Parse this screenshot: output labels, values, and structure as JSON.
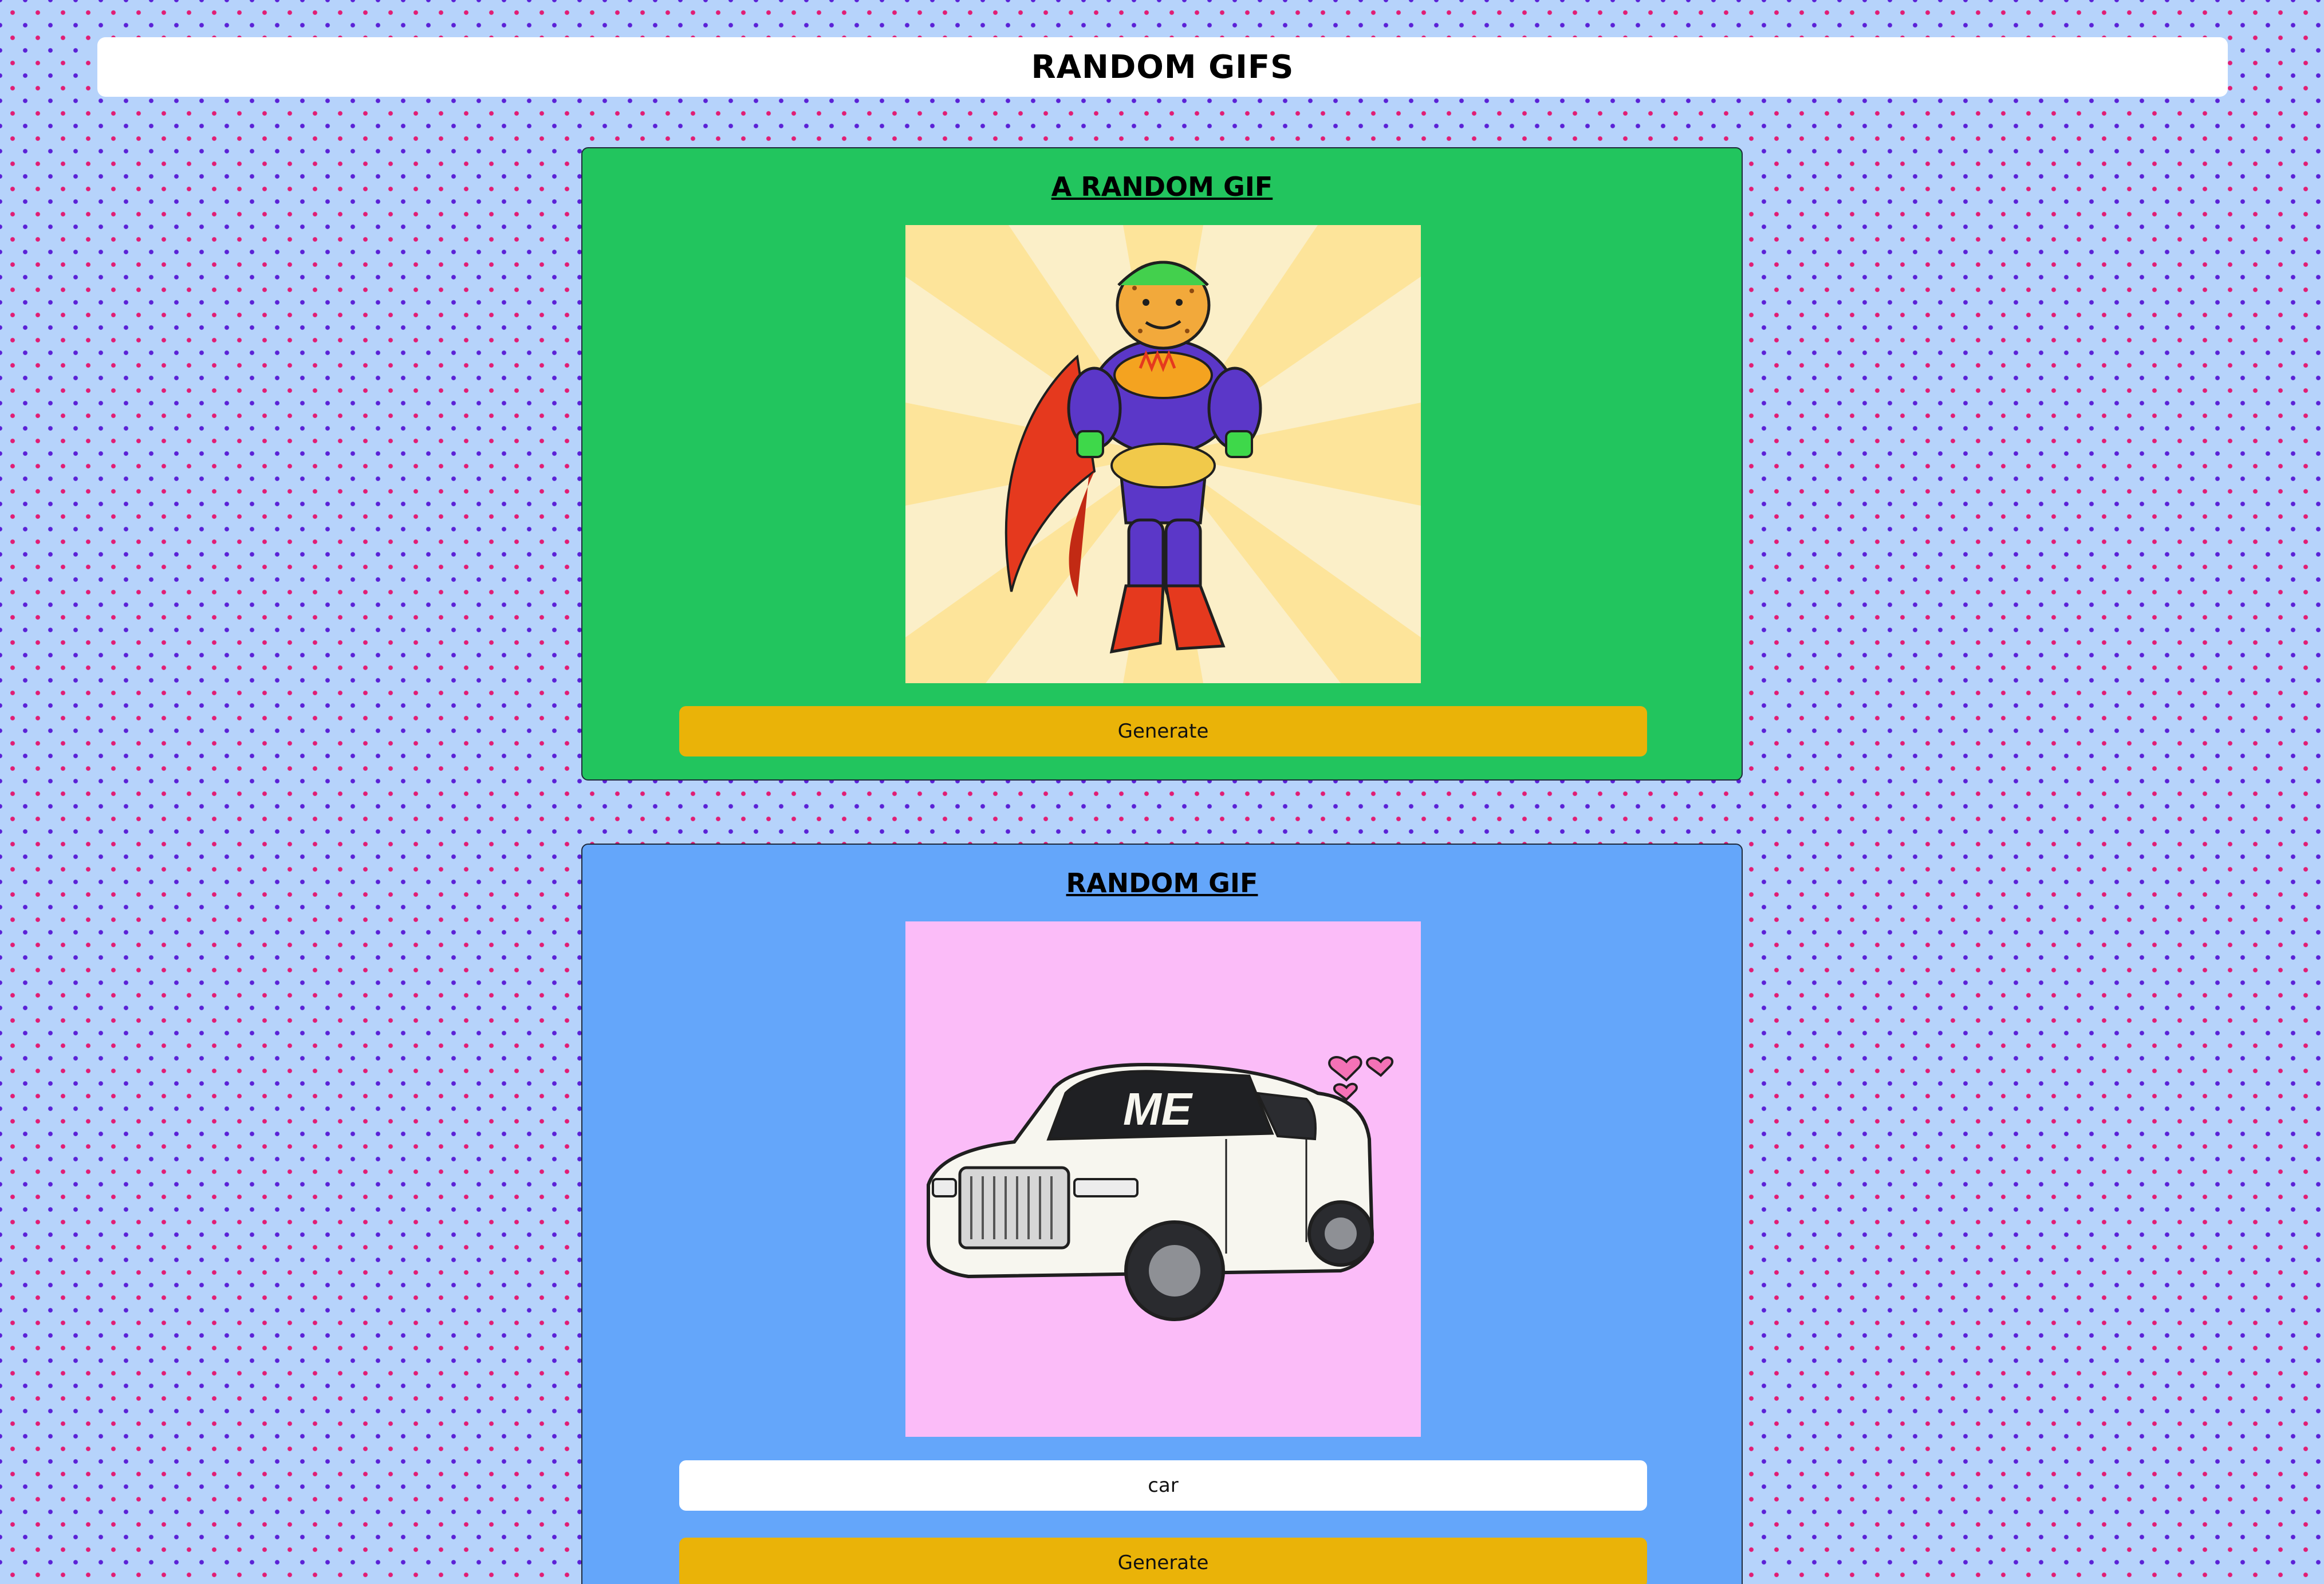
{
  "header": {
    "title": "RANDOM GIFS"
  },
  "random_card": {
    "title": "A RANDOM GIF",
    "gif_alt": "taco superhero gif",
    "generate_label": "Generate",
    "background": "#22c55e"
  },
  "tag_card": {
    "title": "RANDOM GIF",
    "gif_alt": "car gif",
    "gif_caption": "ME",
    "search_value": "car",
    "generate_label": "Generate",
    "background": "#64a6fa"
  },
  "colors": {
    "page_background": "#b6d3fb",
    "dot_pink": "#e11d74",
    "dot_purple": "#5b21d6",
    "button": "#eab308"
  }
}
